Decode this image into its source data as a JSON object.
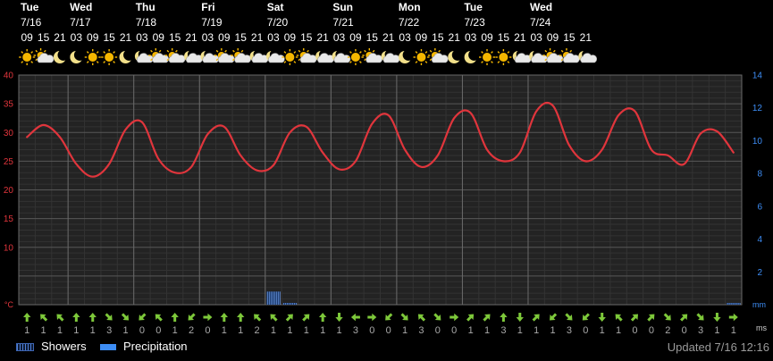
{
  "chart_data": {
    "type": "line",
    "days": [
      {
        "name": "Tue",
        "date": "7/16",
        "hours": [
          "09",
          "15",
          "21"
        ],
        "icons": [
          "sun",
          "sun-cloud",
          "moon"
        ]
      },
      {
        "name": "Wed",
        "date": "7/17",
        "hours": [
          "03",
          "09",
          "15",
          "21"
        ],
        "icons": [
          "moon",
          "sun",
          "sun",
          "moon"
        ]
      },
      {
        "name": "Thu",
        "date": "7/18",
        "hours": [
          "03",
          "09",
          "15",
          "21"
        ],
        "icons": [
          "moon-cloud",
          "sun-cloud",
          "sun-cloud",
          "moon-cloud"
        ]
      },
      {
        "name": "Fri",
        "date": "7/19",
        "hours": [
          "03",
          "09",
          "15",
          "21"
        ],
        "icons": [
          "moon-cloud",
          "sun-cloud",
          "sun-cloud",
          "moon-cloud"
        ]
      },
      {
        "name": "Sat",
        "date": "7/20",
        "hours": [
          "03",
          "09",
          "15",
          "21"
        ],
        "icons": [
          "moon-cloud",
          "sun",
          "sun-cloud",
          "moon-cloud"
        ]
      },
      {
        "name": "Sun",
        "date": "7/21",
        "hours": [
          "03",
          "09",
          "15",
          "21"
        ],
        "icons": [
          "moon-cloud",
          "sun",
          "sun-cloud",
          "moon-cloud"
        ]
      },
      {
        "name": "Mon",
        "date": "7/22",
        "hours": [
          "03",
          "09",
          "15",
          "21"
        ],
        "icons": [
          "moon",
          "sun",
          "sun-cloud",
          "moon"
        ]
      },
      {
        "name": "Tue",
        "date": "7/23",
        "hours": [
          "03",
          "09",
          "15",
          "21"
        ],
        "icons": [
          "moon",
          "sun",
          "sun",
          "moon-cloud"
        ]
      },
      {
        "name": "Wed",
        "date": "7/24",
        "hours": [
          "03",
          "09",
          "15",
          "21"
        ],
        "icons": [
          "moon-cloud",
          "sun-cloud",
          "sun-cloud",
          "moon-cloud"
        ]
      }
    ],
    "temperature": {
      "unit": "°C",
      "ylim": [
        0,
        40
      ],
      "ticks": [
        10,
        15,
        20,
        25,
        30,
        35,
        40
      ],
      "color": "#e0353c",
      "values": [
        29.2,
        31.3,
        29.2,
        24.5,
        22.3,
        24.5,
        30.5,
        31.8,
        25.4,
        23.0,
        24.0,
        29.7,
        31.0,
        26.0,
        23.4,
        24.3,
        30.0,
        31.0,
        26.5,
        23.6,
        25.0,
        31.5,
        33.0,
        27.0,
        24.0,
        26.0,
        32.5,
        33.4,
        27.0,
        25.0,
        26.5,
        33.7,
        34.7,
        27.8,
        25.0,
        27.0,
        33.0,
        33.7,
        27.0,
        26.0,
        24.5,
        29.8,
        30.2,
        26.5
      ]
    },
    "precipitation": {
      "unit": "mm",
      "ylim": [
        0,
        14
      ],
      "ticks": [
        2,
        4,
        6,
        8,
        10,
        12,
        14
      ],
      "showers": [
        0,
        0,
        0,
        0,
        0,
        0,
        0,
        0,
        0,
        0,
        0,
        0,
        0,
        0,
        0,
        0.8,
        0.1,
        0,
        0,
        0,
        0,
        0,
        0,
        0,
        0,
        0,
        0,
        0,
        0,
        0,
        0,
        0,
        0,
        0,
        0,
        0,
        0,
        0,
        0,
        0,
        0,
        0,
        0,
        0.1
      ],
      "precipitation": [
        0,
        0,
        0,
        0,
        0,
        0,
        0,
        0,
        0,
        0,
        0,
        0,
        0,
        0,
        0,
        0,
        0,
        0,
        0,
        0,
        0,
        0,
        0,
        0,
        0,
        0,
        0,
        0,
        0,
        0,
        0,
        0,
        0,
        0,
        0,
        0,
        0,
        0,
        0,
        0,
        0,
        0,
        0,
        0
      ]
    },
    "wind": {
      "unit": "ms",
      "directions": [
        "N",
        "NW",
        "NW",
        "N",
        "N",
        "SE",
        "SE",
        "SW",
        "NW",
        "N",
        "SW",
        "E",
        "N",
        "N",
        "NW",
        "NW",
        "NE",
        "NE",
        "N",
        "S",
        "W",
        "E",
        "SW",
        "SE",
        "NW",
        "SE",
        "E",
        "NE",
        "NE",
        "N",
        "S",
        "NE",
        "SW",
        "SE",
        "SW",
        "S",
        "NW",
        "NE",
        "NE",
        "SE",
        "NE",
        "SE",
        "S",
        "E"
      ],
      "speeds": [
        "1",
        "1",
        "1",
        "1",
        "1",
        "3",
        "1",
        "0",
        "0",
        "1",
        "2",
        "0",
        "1",
        "1",
        "2",
        "1",
        "1",
        "1",
        "1",
        "1",
        "3",
        "0",
        "0",
        "1",
        "3",
        "0",
        "0",
        "1",
        "1",
        "3",
        "1",
        "1",
        "1",
        "3",
        "0",
        "1",
        "1",
        "0",
        "0",
        "2",
        "0",
        "3",
        "1",
        "1"
      ]
    },
    "legend": [
      {
        "label": "Showers",
        "color": "#4f7fd6"
      },
      {
        "label": "Precipitation",
        "color": "#3d8df5"
      }
    ],
    "updated": "Updated 7/16 12:16"
  }
}
